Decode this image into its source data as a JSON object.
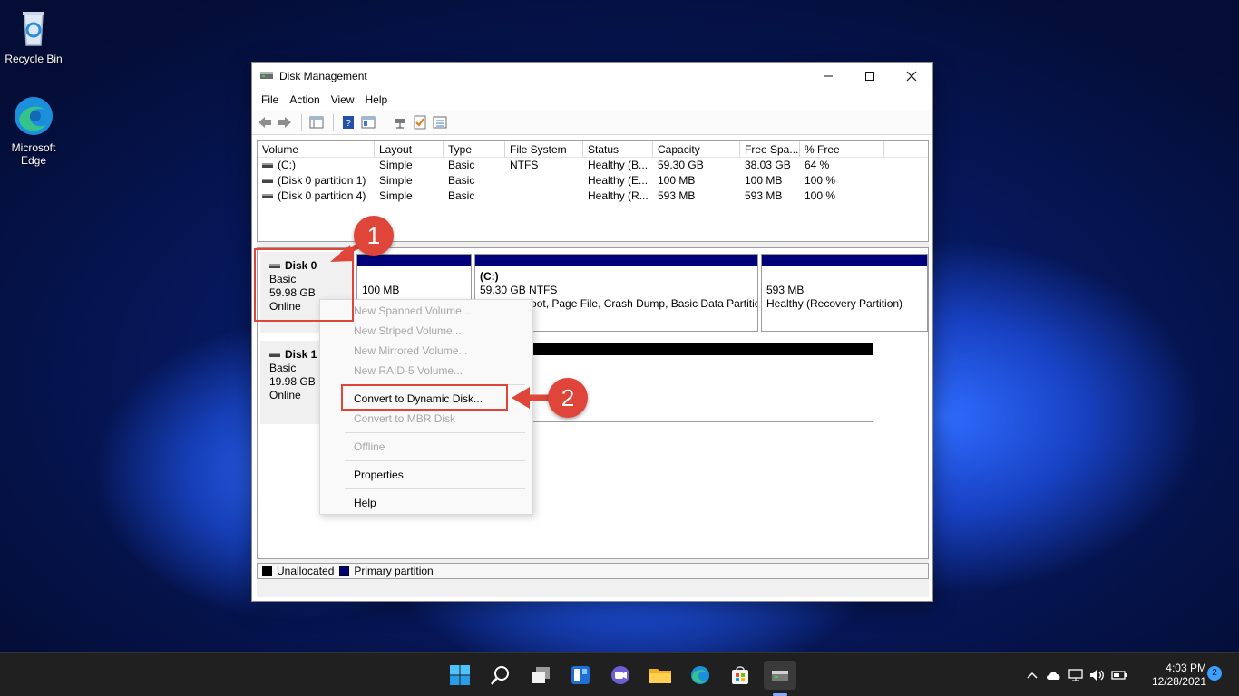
{
  "desktop": {
    "icons": [
      {
        "label": "Recycle Bin"
      },
      {
        "label": "Microsoft Edge"
      }
    ]
  },
  "window": {
    "title": "Disk Management",
    "menu": [
      "File",
      "Action",
      "View",
      "Help"
    ]
  },
  "volumes": {
    "columns": [
      "Volume",
      "Layout",
      "Type",
      "File System",
      "Status",
      "Capacity",
      "Free Spa...",
      "% Free"
    ],
    "rows": [
      [
        "(C:)",
        "Simple",
        "Basic",
        "NTFS",
        "Healthy (B...",
        "59.30 GB",
        "38.03 GB",
        "64 %"
      ],
      [
        "(Disk 0 partition 1)",
        "Simple",
        "Basic",
        "",
        "Healthy (E...",
        "100 MB",
        "100 MB",
        "100 %"
      ],
      [
        "(Disk 0 partition 4)",
        "Simple",
        "Basic",
        "",
        "Healthy (R...",
        "593 MB",
        "593 MB",
        "100 %"
      ]
    ]
  },
  "disks": [
    {
      "name": "Disk 0",
      "type": "Basic",
      "size": "59.98 GB",
      "status": "Online",
      "partitions": [
        {
          "line1": "",
          "line2": "100 MB",
          "line3": ""
        },
        {
          "line1": "(C:)",
          "line2": "59.30 GB NTFS",
          "line3": "Healthy (Boot, Page File, Crash Dump, Basic Data Partition)"
        },
        {
          "line1": "",
          "line2": "593 MB",
          "line3": "Healthy (Recovery Partition)"
        }
      ]
    },
    {
      "name": "Disk 1",
      "type": "Basic",
      "size": "19.98 GB",
      "status": "Online"
    }
  ],
  "legend": {
    "unallocated": "Unallocated",
    "primary": "Primary partition"
  },
  "context_menu": {
    "items": [
      {
        "label": "New Spanned Volume...",
        "enabled": false
      },
      {
        "label": "New Striped Volume...",
        "enabled": false
      },
      {
        "label": "New Mirrored Volume...",
        "enabled": false
      },
      {
        "label": "New RAID-5 Volume...",
        "enabled": false
      },
      {
        "label": "Convert to Dynamic Disk...",
        "enabled": true
      },
      {
        "label": "Convert to MBR Disk",
        "enabled": false
      },
      {
        "label": "Offline",
        "enabled": false
      },
      {
        "label": "Properties",
        "enabled": true
      },
      {
        "label": "Help",
        "enabled": true
      }
    ]
  },
  "callouts": {
    "step1": "1",
    "step2": "2"
  },
  "taskbar": {
    "time": "4:03 PM",
    "date": "12/28/2021",
    "notification_count": "2",
    "apps": [
      "start-icon",
      "search-icon",
      "task-view-icon",
      "widgets-icon",
      "chat-icon",
      "file-explorer-icon",
      "edge-icon",
      "store-icon",
      "disk-management-icon"
    ]
  },
  "colors": {
    "primary_partition": "#00007a",
    "unallocated": "#000000",
    "callout": "#e0453a"
  }
}
